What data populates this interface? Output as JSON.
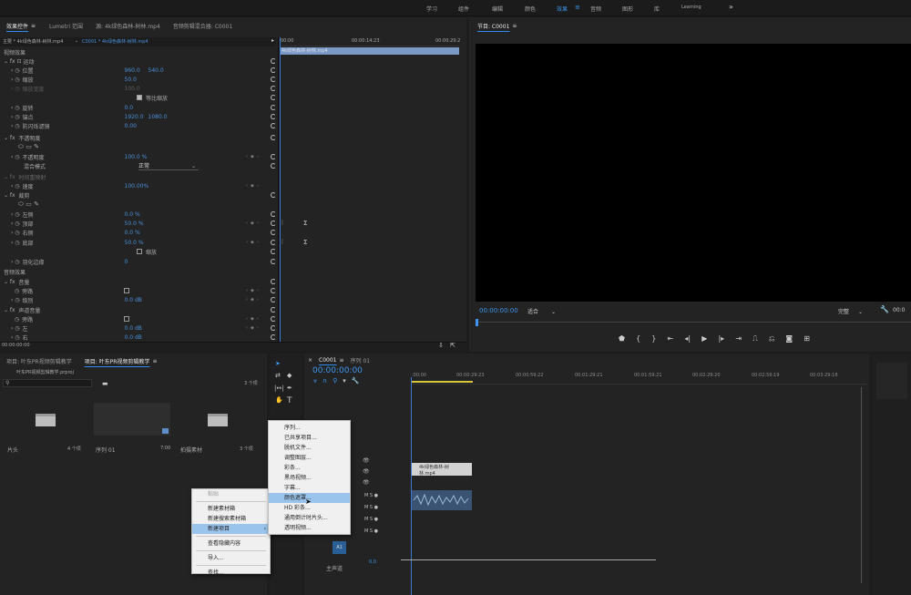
{
  "workspaces": [
    "学习",
    "组件",
    "编辑",
    "颜色",
    "效果",
    "音频",
    "图形",
    "库",
    "Learning"
  ],
  "active_workspace": "效果",
  "effect_panel": {
    "tabs": [
      "效果控件",
      "Lumetri 范围",
      "源: 4k绿色森林-树林.mp4",
      "音频剪辑混合器: C0001"
    ],
    "source_label": "主要 * 4k绿色森林-树林.mp4",
    "seq_label": "C0001 * 4k绿色森林-树林.mp4",
    "tc_start": "00:00",
    "tc_mid": "00:00:14:23",
    "tc_end": "00:00:29:2",
    "clip_name": "4k绿色森林-树林.mp4",
    "video_effects": "视频效果",
    "motion": "运动",
    "position": {
      "label": "位置",
      "x": "960.0",
      "y": "540.0"
    },
    "scale": {
      "label": "缩放",
      "value": "50.0"
    },
    "scale_width": {
      "label": "缩放宽度",
      "value": "100.0"
    },
    "uniform_scale": "等比缩放",
    "rotation": {
      "label": "旋转",
      "value": "0.0"
    },
    "anchor": {
      "label": "锚点",
      "x": "1920.0",
      "y": "1080.0"
    },
    "anti_flicker": {
      "label": "防闪烁滤镜",
      "value": "0.00"
    },
    "opacity": "不透明度",
    "opacity_val": {
      "label": "不透明度",
      "value": "100.0 %"
    },
    "blend_mode": {
      "label": "混合模式",
      "value": "正常"
    },
    "time_remap": "时间重映射",
    "speed": {
      "label": "速度",
      "value": "100.00%"
    },
    "crop": "裁剪",
    "left": {
      "label": "左侧",
      "value": "0.0 %"
    },
    "top": {
      "label": "顶部",
      "value": "50.0 %"
    },
    "right": {
      "label": "右侧",
      "value": "0.0 %"
    },
    "bottom": {
      "label": "底部",
      "value": "50.0 %"
    },
    "zoom": "缩放",
    "feather": {
      "label": "羽化边缘",
      "value": "0"
    },
    "audio_effects": "音频效果",
    "volume": "音量",
    "bypass": "旁路",
    "level": {
      "label": "级别",
      "value": "0.0 dB"
    },
    "channel_volume": "声道音量",
    "bypass2": "旁路",
    "ch_left": {
      "label": "左",
      "value": "0.0 dB"
    },
    "ch_right": {
      "label": "右",
      "value": "0.0 dB"
    },
    "footer_tc": "00:00:00:00"
  },
  "program": {
    "title": "节目: C0001",
    "tc": "00:00:00:00",
    "fit": "适合",
    "quality": "完整"
  },
  "project": {
    "tabs": [
      "项目: 叶东PR视频剪辑教学",
      "项目: 叶东PR视频剪辑教学"
    ],
    "path": "叶东PR视频剪辑教学.prproj",
    "count": "3 个项",
    "bins": [
      {
        "name": "片头",
        "info": "4 个项"
      },
      {
        "name": "序列 01",
        "info": "7:00"
      },
      {
        "name": "拍摄素材",
        "info": "3 个项"
      }
    ]
  },
  "context_menu_1": {
    "items": [
      "粘贴",
      "新建素材箱",
      "新建搜索素材箱",
      "新建项目",
      "查看隐藏内容",
      "导入...",
      "查找..."
    ]
  },
  "context_menu_2": {
    "items": [
      "序列...",
      "已共享项目...",
      "脱机文件...",
      "调整图层...",
      "彩条...",
      "黑场视频...",
      "字幕...",
      "颜色遮罩...",
      "HD 彩条...",
      "通用倒计时片头...",
      "透明视频..."
    ],
    "highlight": "颜色遮罩..."
  },
  "timeline": {
    "tabs": [
      "C0001",
      "序列 01"
    ],
    "tc": "00:00:00:00",
    "ruler": [
      ":00:00",
      "00:00:29:23",
      "00:00:59:22",
      "00:01:29:21",
      "00:01:59:21",
      "00:02:29:20",
      "00:02:59:19",
      "00:03:29:18"
    ],
    "clip_name": "4k绿色森林-树林.mp4",
    "master": "主声道",
    "master_val": "0.0",
    "a_label": "A1"
  }
}
